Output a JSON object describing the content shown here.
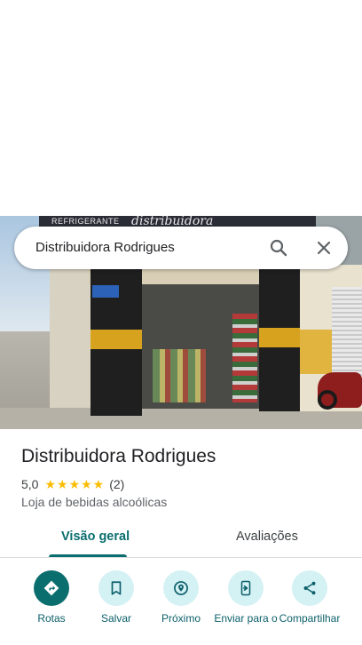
{
  "photo": {
    "sign_left_text": "REFRIGERANTE",
    "sign_right_text": "distribuidora"
  },
  "search": {
    "query": "Distribuidora Rodrigues",
    "search_icon": "search-icon",
    "close_icon": "close-icon"
  },
  "place": {
    "name": "Distribuidora Rodrigues",
    "rating": "5,0",
    "stars": "★★★★★",
    "review_count": "(2)",
    "category": "Loja de bebidas alcoólicas"
  },
  "tabs": [
    {
      "label": "Visão geral",
      "selected": true
    },
    {
      "label": "Avaliações",
      "selected": false
    }
  ],
  "actions": [
    {
      "label": "Rotas",
      "icon": "directions-icon"
    },
    {
      "label": "Salvar",
      "icon": "bookmark-icon"
    },
    {
      "label": "Próximo",
      "icon": "nearby-icon"
    },
    {
      "label": "Enviar para o",
      "icon": "send-to-phone-icon"
    },
    {
      "label": "Compartilhar",
      "icon": "share-icon"
    }
  ],
  "colors": {
    "accent": "#0b6e6e",
    "action_bg": "#d4f1f4",
    "star": "#fbbc04"
  }
}
